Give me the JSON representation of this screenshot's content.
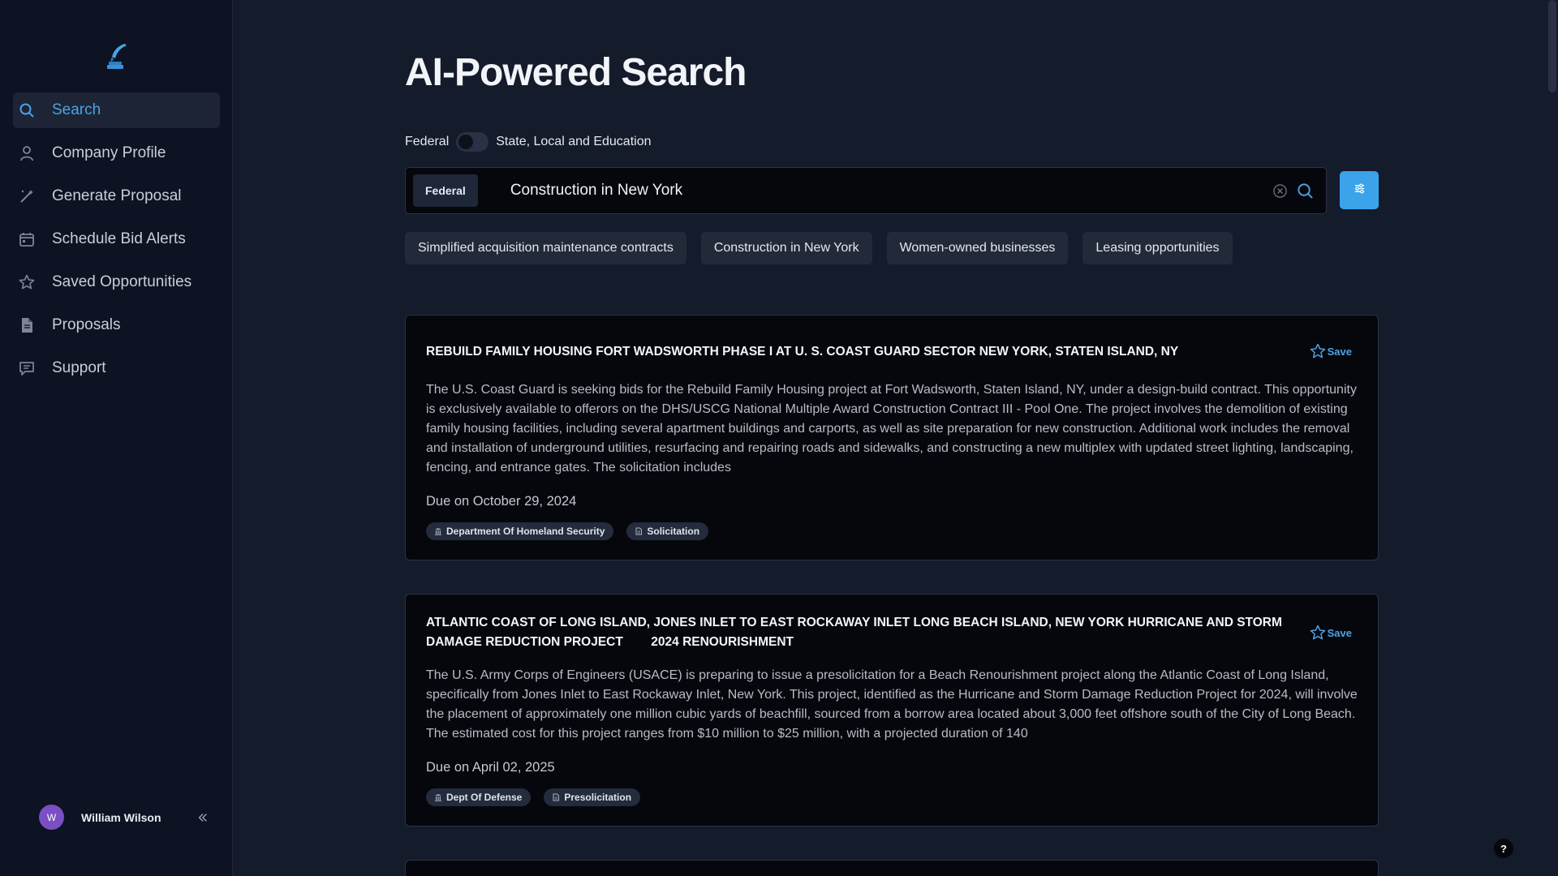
{
  "sidebar": {
    "items": [
      {
        "label": "Search",
        "icon": "search-icon",
        "active": true
      },
      {
        "label": "Company Profile",
        "icon": "user-icon"
      },
      {
        "label": "Generate Proposal",
        "icon": "magic-wand-icon"
      },
      {
        "label": "Schedule Bid Alerts",
        "icon": "calendar-icon"
      },
      {
        "label": "Saved Opportunities",
        "icon": "star-icon"
      },
      {
        "label": "Proposals",
        "icon": "document-icon"
      },
      {
        "label": "Support",
        "icon": "chat-icon"
      }
    ],
    "user": {
      "initial": "W",
      "name": "William Wilson"
    }
  },
  "main": {
    "title": "AI-Powered Search",
    "toggle": {
      "left_label": "Federal",
      "right_label": "State, Local and Education"
    },
    "search": {
      "badge": "Federal",
      "value": "Construction in New York"
    },
    "suggestions": [
      "Simplified acquisition maintenance contracts",
      "Construction in New York",
      "Women-owned businesses",
      "Leasing opportunities"
    ],
    "results": [
      {
        "title": "REBUILD FAMILY HOUSING FORT WADSWORTH PHASE I AT U. S. COAST GUARD SECTOR NEW YORK, STATEN ISLAND, NY",
        "save_label": "Save",
        "description": "The U.S. Coast Guard is seeking bids for the Rebuild Family Housing project at Fort Wadsworth, Staten Island, NY, under a design-build contract. This opportunity is exclusively available to offerors on the DHS/USCG National Multiple Award Construction Contract III - Pool One. The project involves the demolition of existing family housing facilities, including several apartment buildings and carports, as well as site preparation for new construction. Additional work includes the removal and installation of underground utilities, resurfacing and repairing roads and sidewalks, and constructing a new multiplex with updated street lighting, landscaping, fencing, and entrance gates. The solicitation includes",
        "due": "Due on October 29, 2024",
        "agency": "Department Of Homeland Security",
        "type": "Solicitation"
      },
      {
        "title": "ATLANTIC COAST OF LONG ISLAND, JONES INLET TO EAST ROCKAWAY INLET LONG BEACH ISLAND, NEW YORK HURRICANE AND STORM DAMAGE REDUCTION PROJECT        2024 RENOURISHMENT",
        "save_label": "Save",
        "description": "The U.S. Army Corps of Engineers (USACE) is preparing to issue a presolicitation for a Beach Renourishment project along the Atlantic Coast of Long Island, specifically from Jones Inlet to East Rockaway Inlet, New York. This project, identified as the Hurricane and Storm Damage Reduction Project for 2024, will involve the placement of approximately one million cubic yards of beachfill, sourced from a borrow area located about 3,000 feet offshore south of the City of Long Beach. The estimated cost for this project ranges from $10 million to $25 million, with a projected duration of 140",
        "due": "Due on April 02, 2025",
        "agency": "Dept Of Defense",
        "type": "Presolicitation"
      }
    ],
    "help_label": "?"
  },
  "colors": {
    "accent": "#3aa3ea",
    "background": "#141b2b",
    "sidebar": "#0d1322",
    "card": "#05070c"
  }
}
